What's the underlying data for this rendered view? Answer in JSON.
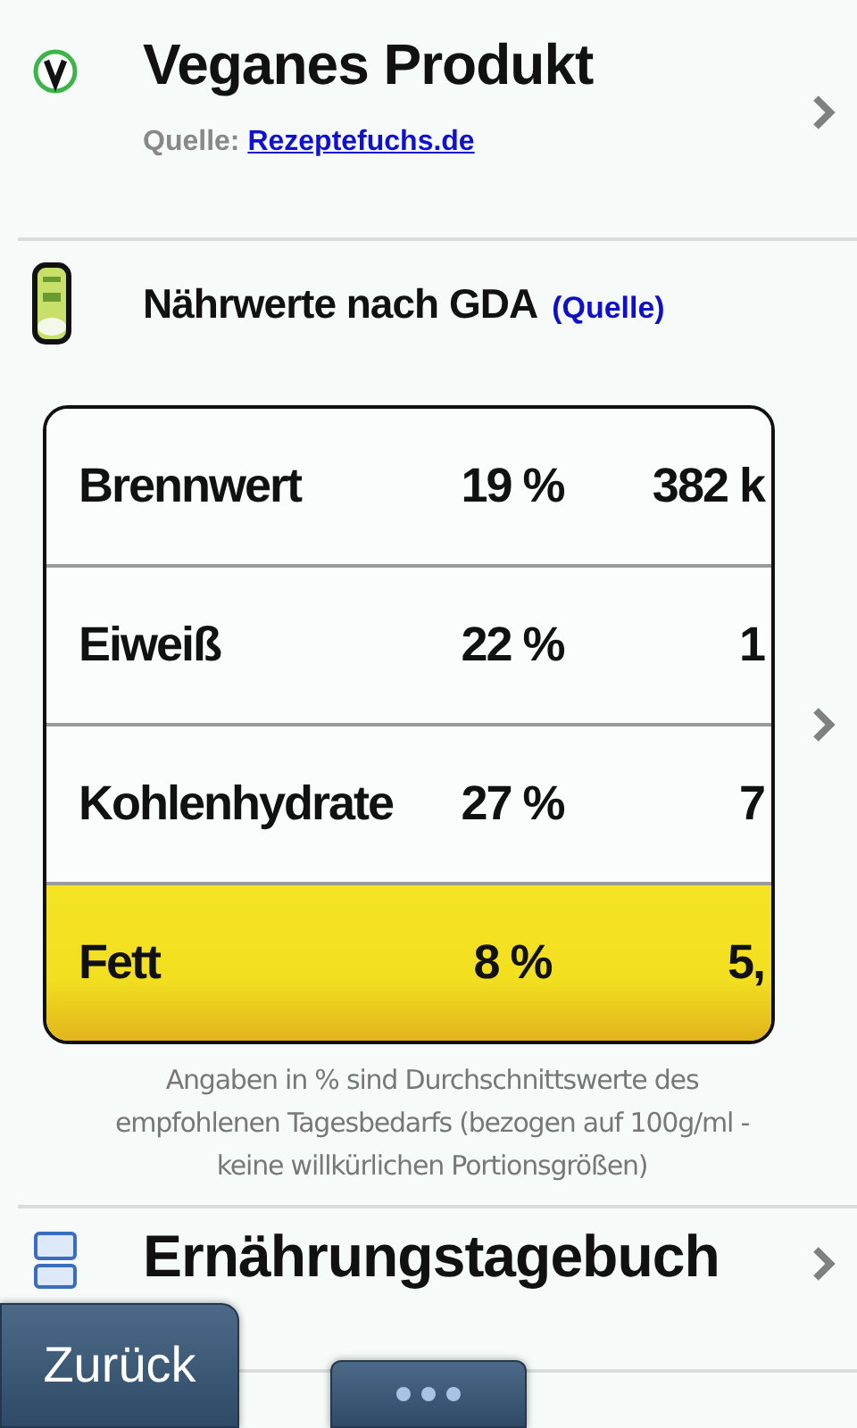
{
  "product": {
    "title": "Veganes Produkt",
    "source_label": "Quelle:",
    "source_link": "Rezeptefuchs.de"
  },
  "nutrition": {
    "title": "Nährwerte nach GDA",
    "source_link": "(Quelle)",
    "rows": [
      {
        "name": "Brennwert",
        "percent": "19 %",
        "amount": "382 k",
        "highlighted": false
      },
      {
        "name": "Eiweiß",
        "percent": "22 %",
        "amount": "1",
        "highlighted": false
      },
      {
        "name": "Kohlenhydrate",
        "percent": "27 %",
        "amount": "7",
        "highlighted": false
      },
      {
        "name": "Fett",
        "percent": "8 %",
        "amount": "5,",
        "highlighted": true
      }
    ],
    "note": "Angaben in % sind Durchschnittswerte des empfohlenen Tagesbedarfs (bezogen auf 100g/ml - keine willkürlichen Portionsgrößen)"
  },
  "diary": {
    "title": "Ernährungstagebuch"
  },
  "toolbar": {
    "back": "Zurück"
  }
}
